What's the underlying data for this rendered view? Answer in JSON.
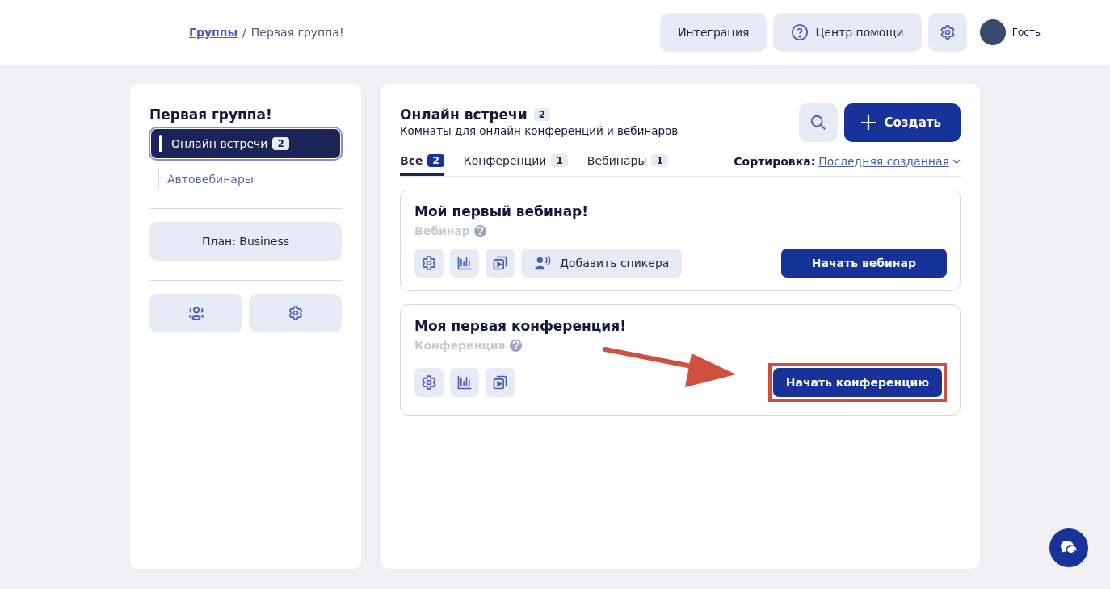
{
  "header": {
    "breadcrumb_separator": "/",
    "breadcrumb": [
      {
        "label": "Группы",
        "kind": "link"
      },
      {
        "label": "Первая группа!",
        "kind": "current"
      }
    ],
    "buttons": [
      {
        "label": "Интеграция",
        "kind": "text"
      },
      {
        "label": "Центр помощи",
        "kind": "help"
      },
      {
        "kind": "settings"
      }
    ],
    "user": {
      "name": "Гость"
    }
  },
  "sidebar": {
    "title": "Первая группа!",
    "items": [
      {
        "label": "Онлайн встречи",
        "count": "2",
        "selected": true
      },
      {
        "label": "Автовебинары",
        "selected": false
      }
    ],
    "plan_button": "План: Business"
  },
  "main": {
    "title": "Онлайн встречи",
    "count": "2",
    "subtitle": "Комнаты для онлайн конференций и вебинаров",
    "create_button": "Создать",
    "tabs": [
      {
        "label": "Все",
        "count": "2",
        "selected": true
      },
      {
        "label": "Конференции",
        "count": "1",
        "selected": false
      },
      {
        "label": "Вебинары",
        "count": "1",
        "selected": false
      }
    ],
    "sort_label": "Сортировка:",
    "sort_value": "Последняя созданная",
    "rooms": [
      {
        "title": "Мой первый вебинар!",
        "type": "Вебинар",
        "speaker_button": "Добавить спикера",
        "action": "Начать вебинар",
        "highlighted": false
      },
      {
        "title": "Моя первая конференция!",
        "type": "Конференция",
        "action": "Начать конференцию",
        "highlighted": true
      }
    ]
  }
}
